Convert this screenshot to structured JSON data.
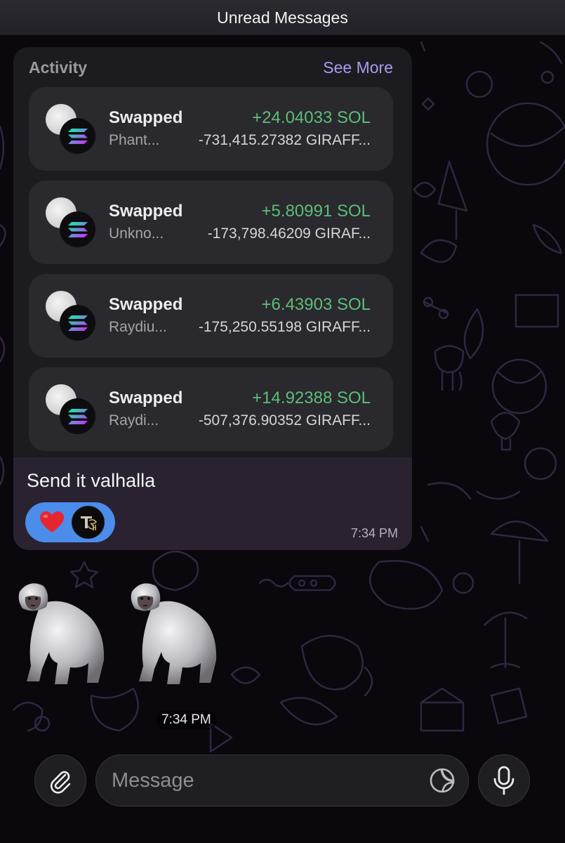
{
  "header": {
    "unread_label": "Unread Messages"
  },
  "activity": {
    "title": "Activity",
    "see_more": "See More",
    "items": [
      {
        "type": "Swapped",
        "amount": "+24.04033 SOL",
        "source": "Phant...",
        "delta": "-731,415.27382 GIRAFF..."
      },
      {
        "type": "Swapped",
        "amount": "+5.80991 SOL",
        "source": "Unkno...",
        "delta": "-173,798.46209 GIRAF..."
      },
      {
        "type": "Swapped",
        "amount": "+6.43903 SOL",
        "source": "Raydiu...",
        "delta": "-175,250.55198 GIRAFF..."
      },
      {
        "type": "Swapped",
        "amount": "+14.92388 SOL",
        "source": "Raydi...",
        "delta": "-507,376.90352 GIRAFF..."
      }
    ]
  },
  "message": {
    "text": "Send it valhalla",
    "time": "7:34 PM",
    "reactions": [
      "heart-emoji",
      "user-avatar"
    ]
  },
  "sticker_message": {
    "stickers": [
      "gorilla-emoji",
      "gorilla-emoji"
    ],
    "time": "7:34 PM"
  },
  "composer": {
    "placeholder": "Message"
  },
  "colors": {
    "accent_link": "#a99cf0",
    "positive_amount": "#5bbf78",
    "reaction_bubble": "#4c8ceb",
    "message_bubble": "#2a2231"
  }
}
